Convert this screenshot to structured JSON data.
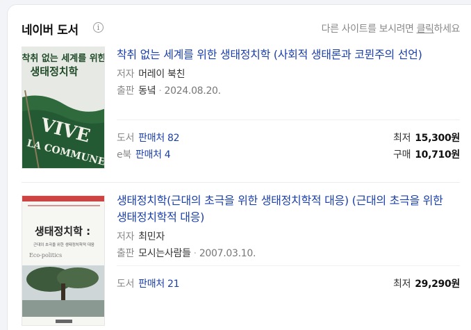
{
  "header": {
    "title": "네이버 도서",
    "info_icon": "i",
    "notice_before": "다른 사이트를 보시려면 ",
    "notice_link": "클릭",
    "notice_after": "하세요"
  },
  "books": [
    {
      "title": "착취 없는 세계를 위한 생태정치학 (사회적 생태론과 코뮌주의 선언)",
      "author_label": "저자",
      "author": "머레이 북친",
      "publisher_label": "출판",
      "publisher": "동녘",
      "date": "2024.08.20.",
      "cover": {
        "title_line1": "착취 없는 세계를 위한",
        "title_line2": "생태정치학",
        "flag_text1": "VIVE",
        "flag_text2": "LA COMMUNE"
      },
      "stores": [
        {
          "label": "도서",
          "link": "판매처 82"
        },
        {
          "label": "e북",
          "link": "판매처 4"
        }
      ],
      "prices": [
        {
          "label": "최저",
          "value": "15,300원"
        },
        {
          "label": "구매",
          "value": "10,710원"
        }
      ]
    },
    {
      "title": "생태정치학(근대의 초극을 위한 생태정치학적 대응) (근대의 초극을 위한 생태정치학적 대응)",
      "author_label": "저자",
      "author": "최민자",
      "publisher_label": "출판",
      "publisher": "모시는사람들",
      "date": "2007.03.10.",
      "cover": {
        "title_line1": "생태정치학 :",
        "title_line2": "근대의 초극을 위한 생태정치학적 대응",
        "eng": "Eco-politics"
      },
      "stores": [
        {
          "label": "도서",
          "link": "판매처 21"
        }
      ],
      "prices": [
        {
          "label": "최저",
          "value": "29,290원"
        }
      ]
    }
  ]
}
